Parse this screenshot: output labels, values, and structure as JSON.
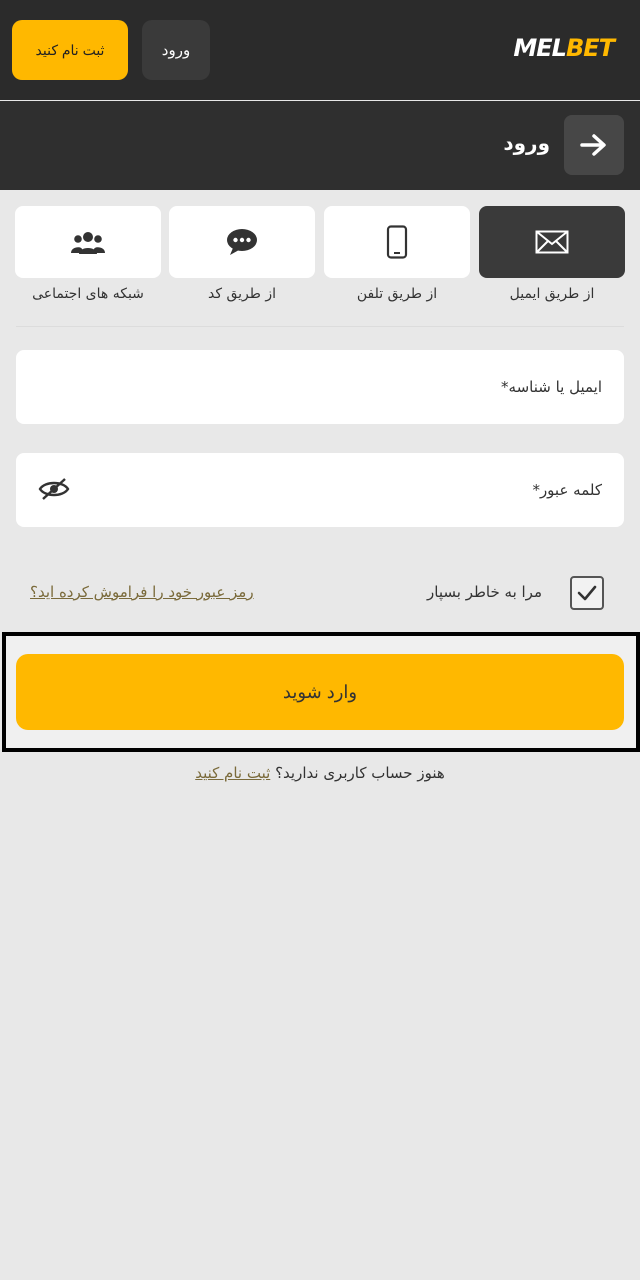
{
  "header": {
    "register_label": "ثبت نام کنید",
    "login_label": "ورود",
    "logo_part1": "MEL",
    "logo_part2": "BET"
  },
  "subheader": {
    "title": "ورود",
    "back_icon": "arrow-right-icon"
  },
  "login_methods": [
    {
      "label": "از طریق ایمیل",
      "icon": "envelope-icon",
      "active": true
    },
    {
      "label": "از طریق تلفن",
      "icon": "phone-icon",
      "active": false
    },
    {
      "label": "از طریق کد",
      "icon": "chat-icon",
      "active": false
    },
    {
      "label": "شبکه های اجتماعی",
      "icon": "group-icon",
      "active": false
    }
  ],
  "form": {
    "email_label": "ایمیل یا شناسه*",
    "password_label": "کلمه عبور*",
    "remember_label": "مرا به خاطر بسپار",
    "remember_checked": true,
    "forgot_link": "رمز عبور خود را فراموش کرده اید؟",
    "submit_label": "وارد شوید"
  },
  "signup": {
    "text": "هنوز حساب کاربری ندارید؟",
    "link": "ثبت نام کنید"
  },
  "colors": {
    "accent": "#ffb800",
    "header_bg": "#2b2b2b",
    "page_bg": "#e8e8e8"
  }
}
